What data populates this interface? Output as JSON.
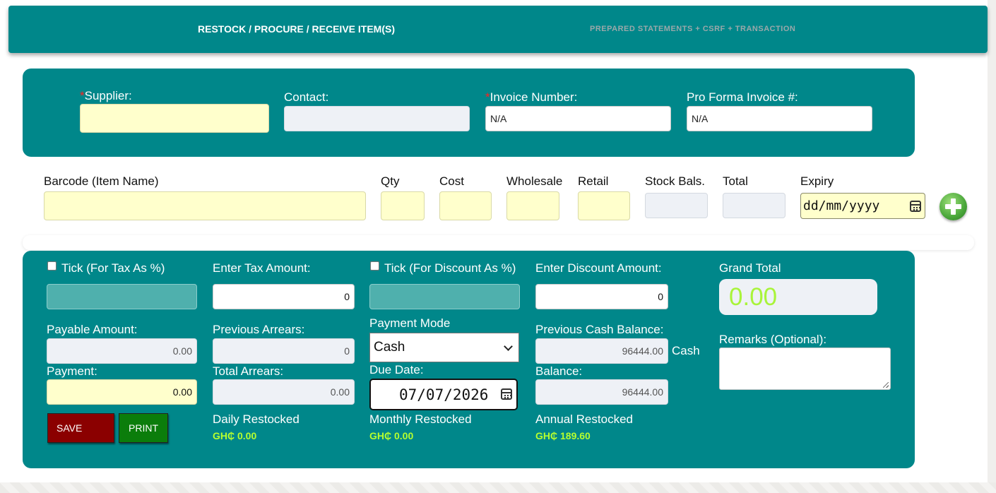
{
  "tabs": {
    "restock": "RESTOCK / PROCURE / RECEIVE ITEM(S)",
    "prepared": "PREPARED STATEMENTS + CSRF + TRANSACTION"
  },
  "supplier_panel": {
    "required_mark": "*",
    "supplier_label": "Supplier:",
    "supplier_value": "",
    "contact_label": "Contact:",
    "contact_value": "",
    "invoice_label": "Invoice Number:",
    "invoice_value": "N/A",
    "proforma_label": "Pro Forma Invoice #:",
    "proforma_value": "N/A"
  },
  "item_row": {
    "barcode_label": "Barcode (Item Name)",
    "qty_label": "Qty",
    "cost_label": "Cost",
    "wholesale_label": "Wholesale",
    "retail_label": "Retail",
    "stock_label": "Stock Bals.",
    "total_label": "Total",
    "expiry_label": "Expiry",
    "expiry_placeholder": "dd/mm/yyyy"
  },
  "totals_panel": {
    "tax_tick_label": "Tick (For Tax As %)",
    "tax_amount_label": "Enter Tax Amount:",
    "tax_amount_value": "0",
    "discount_tick_label": "Tick (For Discount As %)",
    "discount_amount_label": "Enter Discount Amount:",
    "discount_amount_value": "0",
    "grand_total_label": "Grand Total",
    "grand_total_value": "0.00",
    "payable_label": "Payable Amount:",
    "payable_value": "0.00",
    "payment_label": "Payment:",
    "payment_value": "0.00",
    "prev_arrears_label": "Previous Arrears:",
    "prev_arrears_value": "0",
    "total_arrears_label": "Total Arrears:",
    "total_arrears_value": "0.00",
    "payment_mode_label": "Payment Mode",
    "payment_mode_value": "Cash",
    "due_date_label": "Due Date:",
    "due_date_value": "07/07/2026",
    "prev_cash_label": "Previous Cash Balance:",
    "prev_cash_value": "96444.00",
    "cash_label": "Cash",
    "balance_label": "Balance:",
    "balance_value": "96444.00",
    "remarks_label": "Remarks (Optional):",
    "save_label": "SAVE",
    "print_label": "PRINT",
    "daily_label": "Daily Restocked",
    "daily_value": "GH₵ 0.00",
    "monthly_label": "Monthly Restocked",
    "monthly_value": "GH₵ 0.00",
    "annual_label": "Annual Restocked",
    "annual_value": "GH₵ 189.60"
  },
  "colors": {
    "teal": "#00878a",
    "yellow_field": "#ffffcc",
    "save": "#8b0000",
    "print": "#0b7d0b",
    "money": "#b6ff2f"
  }
}
